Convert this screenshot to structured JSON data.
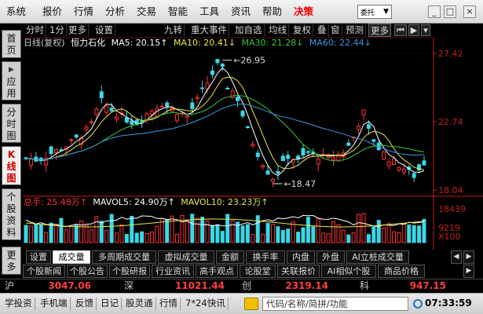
{
  "menu": {
    "items": [
      "系统",
      "报价",
      "行情",
      "分析",
      "交易",
      "智能",
      "工具",
      "资讯",
      "帮助",
      "决策"
    ],
    "entrust": "委托",
    "entrust_arrow": "▼"
  },
  "window_buttons": [
    "_",
    "□",
    "×"
  ],
  "left_tabs": [
    {
      "label": "首页"
    },
    {
      "label": "应用",
      "arrow": "▶"
    },
    {
      "label": "分时图"
    },
    {
      "label": "K线图",
      "k": "K"
    },
    {
      "label": "个股资料"
    },
    {
      "label": "更多"
    }
  ],
  "toolbar": {
    "left": [
      "分时",
      "1分",
      "更多",
      "设置"
    ],
    "right": [
      "九转",
      "重大事件",
      "加自选",
      "均线",
      "复权",
      "叠",
      "窗",
      "预测",
      "更多"
    ]
  },
  "legend": {
    "name": "日线(复权)",
    "stock": "恒力石化",
    "ma5": "MA5: 20.15↑",
    "ma10": "MA10: 20.41↓",
    "ma30": "MA30: 21.28↓",
    "ma60": "MA60: 22.44↓"
  },
  "chart_data": {
    "type": "candlestick",
    "price_axis_labels": [
      "27.42",
      "22.74",
      "18.04"
    ],
    "price_axis": [
      27.42,
      22.74,
      18.04
    ],
    "annotations": [
      {
        "label": "26.95",
        "value": 26.95,
        "type": "high"
      },
      {
        "label": "18.47",
        "value": 18.47,
        "type": "low"
      }
    ],
    "volume_axis_labels": [
      "18439",
      "9219",
      "X100"
    ],
    "volume_axis": [
      18439,
      9219
    ],
    "volume_unit": "X100"
  },
  "volume_legend": {
    "total": "总手: 25.48万↑",
    "mavol5": "MAVOL5: 24.90万↑",
    "mavol10": "MAVOL10: 23.23万↑"
  },
  "tabs_row1": [
    "设置",
    "成交量",
    "多周期成交量",
    "虚拟成交量",
    "金额",
    "换手率",
    "内盘",
    "外盘",
    "AI立桩成交量"
  ],
  "tabs_row1_selected": "成交量",
  "tabs_row2": [
    "个股新闻",
    "个股公告",
    "个股研报",
    "行业资讯",
    "高手观点",
    "论股堂",
    "关联报价",
    "AI相似个股",
    "商品价格"
  ],
  "index_bar": [
    {
      "name": "沪",
      "value": "3047.06"
    },
    {
      "name": "深",
      "value": "11021.44"
    },
    {
      "name": "创",
      "value": "2319.14"
    },
    {
      "name": "科",
      "value": "947.15"
    }
  ],
  "status": {
    "items": [
      "学投资",
      "手机端",
      "反馈",
      "日记",
      "股灵通",
      "行情",
      "7*24快讯"
    ],
    "search_placeholder": "代码/名称/简拼/功能",
    "clock": "07:33:59"
  },
  "colors": {
    "up": "#ff3232",
    "down": "#3ad8e6",
    "ma5": "#ffffff",
    "ma10": "#e8e84a",
    "ma30": "#3ac83a",
    "ma60": "#3a98e6",
    "axis": "#c81e1e"
  }
}
